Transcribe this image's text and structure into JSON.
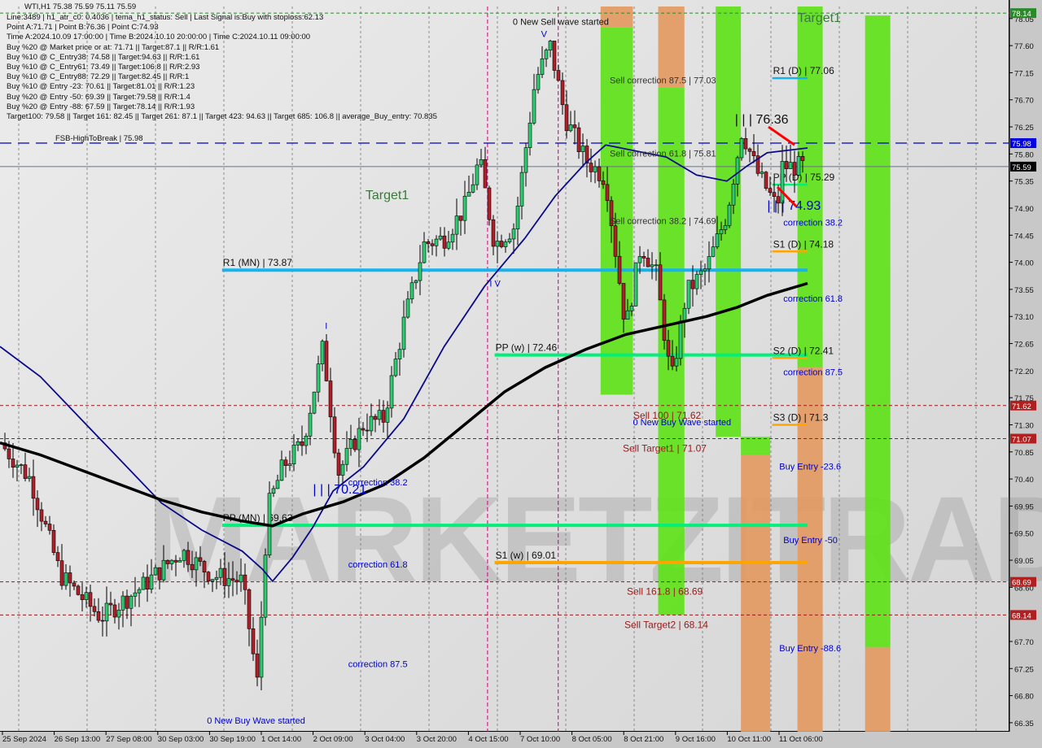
{
  "header": {
    "symbol_line": "WTI,H1  75.38 75.59 75.11 75.59",
    "info_lines": [
      "Line:3489 | h1_atr_c0: 0.4036 | tema_h1_status: Sell | Last Signal is:Buy with stoploss:62.13",
      "Point A:71.71 | Point B:76.36 | Point C:74.93",
      "Time A:2024.10.09 17:00:00 | Time B:2024.10.10 20:00:00 | Time C:2024.10.11 09:00:00",
      "Buy %20 @ Market price or at: 71.71 || Target:87.1 || R/R:1.61",
      "Buy %10 @ C_Entry38: 74.58 || Target:94.63 || R/R:1.61",
      "Buy %10 @ C_Entry61: 73.49 || Target:106.8 || R/R:2.93",
      "Buy %10 @ C_Entry88: 72.29 || Target:82.45 || R/R:1",
      "Buy %10 @ Entry -23: 70.61 || Target:81.01 || R/R:1.23",
      "Buy %20 @ Entry -50: 69.39 || Target:79.58 || R/R:1.4",
      "Buy %20 @ Entry -88: 67.59 || Target:78.14 || R/R:1.93",
      "Target100: 79.58 || Target 161: 82.45 || Target 261: 87.1 || Target 423: 94.63 || Target 685: 106.8 || average_Buy_entry: 70.835"
    ]
  },
  "watermark": "MARKETZITRADE",
  "colors": {
    "bull": "#2ecc71",
    "bear": "#b0202a",
    "ema_blue": "#0a0a8a",
    "ema_black": "#000000",
    "zone_green": "#5fe21a",
    "zone_green_dark": "#46c81e",
    "zone_orange": "#e39a62",
    "pivot_cyan": "#16b4ef",
    "pivot_green": "#00f07a",
    "pivot_orange": "#ffa500",
    "sell_red_line": "#9a1818",
    "current_price_bg": "#000000",
    "fsb_bg": "#0000e0",
    "target_bg": "#2a8a2a",
    "level_bg": "#b02020"
  },
  "chart_data": {
    "type": "candlestick",
    "title": "WTI,H1",
    "ohlc_last": {
      "open": 75.38,
      "high": 75.59,
      "low": 75.11,
      "close": 75.59
    },
    "ylim": [
      66.2,
      78.25
    ],
    "y_ticks": [
      "78.05",
      "77.60",
      "77.15",
      "76.70",
      "76.25",
      "75.80",
      "75.35",
      "74.90",
      "74.45",
      "74.00",
      "73.55",
      "73.10",
      "72.65",
      "72.20",
      "71.75",
      "71.30",
      "70.85",
      "70.40",
      "69.95",
      "69.50",
      "69.05",
      "68.60",
      "67.70",
      "67.25",
      "66.80",
      "66.35"
    ],
    "x_ticks": [
      "25 Sep 2024",
      "26 Sep 13:00",
      "27 Sep 08:00",
      "30 Sep 03:00",
      "30 Sep 19:00",
      "1 Oct 14:00",
      "2 Oct 09:00",
      "3 Oct 04:00",
      "3 Oct 20:00",
      "4 Oct 15:00",
      "7 Oct 10:00",
      "8 Oct 05:00",
      "8 Oct 21:00",
      "9 Oct 16:00",
      "10 Oct 11:00",
      "11 Oct 06:00"
    ],
    "price_tags": [
      {
        "value": "78.14",
        "kind": "target"
      },
      {
        "value": "75.98",
        "kind": "fsb"
      },
      {
        "value": "75.59",
        "kind": "current"
      },
      {
        "value": "71.62",
        "kind": "level"
      },
      {
        "value": "71.07",
        "kind": "level"
      },
      {
        "value": "68.69",
        "kind": "level"
      },
      {
        "value": "68.14",
        "kind": "level"
      }
    ],
    "horizontal_levels": [
      {
        "label": "FSB-HighToBreak | 75.98",
        "price": 75.98,
        "style": "dashed-blue"
      },
      {
        "label": "",
        "price": 75.59,
        "style": "solid-gray"
      },
      {
        "label": "Target1",
        "price": 78.14,
        "style": "dashed-green"
      },
      {
        "label": "Sell 100 | 71.62",
        "price": 71.62,
        "style": "dashed-red"
      },
      {
        "label": "Sell Target1 | 71.07",
        "price": 71.07,
        "style": "dashed-red"
      },
      {
        "label": "Sell 161.8 | 68.69",
        "price": 68.69,
        "style": "dashed-red"
      },
      {
        "label": "Sell Target2 | 68.14",
        "price": 68.14,
        "style": "dashed-red"
      }
    ],
    "pivots": [
      {
        "label": "R1 (MN) | 73.87",
        "price": 73.87,
        "color": "cyan",
        "x0": 0.22,
        "x1": 0.8
      },
      {
        "label": "PP (MN) | 69.63",
        "price": 69.63,
        "color": "green",
        "x0": 0.22,
        "x1": 0.8
      },
      {
        "label": "PP (w) | 72.46",
        "price": 72.46,
        "color": "green",
        "x0": 0.49,
        "x1": 0.8
      },
      {
        "label": "S1 (w) | 69.01",
        "price": 69.01,
        "color": "orange",
        "x0": 0.49,
        "x1": 0.8
      },
      {
        "label": "R1 (D) | 77.06",
        "price": 77.06,
        "color": "cyan",
        "x0": 0.765,
        "x1": 0.8
      },
      {
        "label": "PP (D) | 75.29",
        "price": 75.29,
        "color": "green",
        "x0": 0.765,
        "x1": 0.8
      },
      {
        "label": "S1 (D) | 74.18",
        "price": 74.18,
        "color": "orange",
        "x0": 0.765,
        "x1": 0.8
      },
      {
        "label": "S2 (D) | 72.41",
        "price": 72.41,
        "color": "orange",
        "x0": 0.765,
        "x1": 0.8
      },
      {
        "label": "S3 (D) | 71.3",
        "price": 71.3,
        "color": "orange",
        "x0": 0.765,
        "x1": 0.8
      }
    ],
    "annotations": [
      {
        "text": "0 New Sell wave started",
        "price": 78.0,
        "xf": 0.508,
        "color": "#111"
      },
      {
        "text": "Sell correction 87.5 | 77.03",
        "price": 77.03,
        "xf": 0.604,
        "color": "#333"
      },
      {
        "text": "Sell correction 61.8 | 75.81",
        "price": 75.81,
        "xf": 0.604,
        "color": "#333"
      },
      {
        "text": "Sell correction 38.2 | 74.69",
        "price": 74.69,
        "xf": 0.604,
        "color": "#333"
      },
      {
        "text": "| | | 76.36",
        "price": 76.36,
        "xf": 0.728,
        "color": "#111",
        "big": true
      },
      {
        "text": "| | | 74.93",
        "price": 74.93,
        "xf": 0.76,
        "color": "#0000cc",
        "big": true
      },
      {
        "text": "| | | 70.21",
        "price": 70.21,
        "xf": 0.31,
        "color": "#0000cc",
        "big": true
      },
      {
        "text": "correction 38.2",
        "price": 74.66,
        "xf": 0.776,
        "color": "#0000cc"
      },
      {
        "text": "correction 61.8",
        "price": 73.4,
        "xf": 0.776,
        "color": "#0000cc"
      },
      {
        "text": "correction 87.5",
        "price": 72.18,
        "xf": 0.776,
        "color": "#0000cc"
      },
      {
        "text": "Buy Entry -23.6",
        "price": 70.61,
        "xf": 0.772,
        "color": "#0000cc"
      },
      {
        "text": "Buy Entry -50",
        "price": 69.39,
        "xf": 0.776,
        "color": "#0000cc"
      },
      {
        "text": "Buy Entry -88.6",
        "price": 67.59,
        "xf": 0.772,
        "color": "#0000cc"
      },
      {
        "text": "correction 38.2",
        "price": 70.35,
        "xf": 0.345,
        "color": "#0000cc"
      },
      {
        "text": "correction 61.8",
        "price": 68.98,
        "xf": 0.345,
        "color": "#0000cc"
      },
      {
        "text": "correction 87.5",
        "price": 67.33,
        "xf": 0.345,
        "color": "#0000cc"
      },
      {
        "text": "0 New Buy Wave started",
        "price": 66.39,
        "xf": 0.205,
        "color": "#0000cc"
      },
      {
        "text": "0 New Buy Wave started",
        "price": 71.35,
        "xf": 0.627,
        "color": "#0000cc"
      },
      {
        "text": "Target1",
        "price": 75.1,
        "xf": 0.362,
        "color": "#3a7a3a",
        "big": true
      },
      {
        "text": "Target1",
        "price": 78.05,
        "xf": 0.79,
        "color": "#3a7a3a",
        "big": true
      },
      {
        "text": "I V",
        "price": 73.65,
        "xf": 0.485,
        "color": "#0000cc"
      },
      {
        "text": "I",
        "price": 72.95,
        "xf": 0.322,
        "color": "#0000cc"
      },
      {
        "text": "V",
        "price": 77.8,
        "xf": 0.536,
        "color": "#0000cc"
      }
    ],
    "zones": [
      {
        "x0": 0.595,
        "x1": 0.627,
        "top": 78.25,
        "bottom": 77.9,
        "color": "orange"
      },
      {
        "x0": 0.595,
        "x1": 0.627,
        "top": 77.9,
        "bottom": 71.8,
        "color": "green"
      },
      {
        "x0": 0.652,
        "x1": 0.678,
        "top": 78.25,
        "bottom": 76.9,
        "color": "orange"
      },
      {
        "x0": 0.652,
        "x1": 0.678,
        "top": 76.9,
        "bottom": 68.14,
        "color": "green"
      },
      {
        "x0": 0.709,
        "x1": 0.734,
        "top": 78.25,
        "bottom": 71.1,
        "color": "green"
      },
      {
        "x0": 0.734,
        "x1": 0.763,
        "top": 71.1,
        "bottom": 70.8,
        "color": "green"
      },
      {
        "x0": 0.734,
        "x1": 0.763,
        "top": 70.8,
        "bottom": 66.2,
        "color": "orange"
      },
      {
        "x0": 0.79,
        "x1": 0.815,
        "top": 78.25,
        "bottom": 72.25,
        "color": "green"
      },
      {
        "x0": 0.79,
        "x1": 0.815,
        "top": 72.25,
        "bottom": 66.2,
        "color": "orange"
      },
      {
        "x0": 0.857,
        "x1": 0.882,
        "top": 78.1,
        "bottom": 67.6,
        "color": "green"
      },
      {
        "x0": 0.857,
        "x1": 0.882,
        "top": 67.6,
        "bottom": 66.2,
        "color": "orange"
      }
    ],
    "series": [
      {
        "name": "EMA fast (blue)",
        "color": "#0a0a8a",
        "points": [
          [
            0.0,
            72.6
          ],
          [
            0.04,
            72.1
          ],
          [
            0.08,
            71.4
          ],
          [
            0.12,
            70.7
          ],
          [
            0.16,
            70.0
          ],
          [
            0.2,
            69.55
          ],
          [
            0.24,
            69.2
          ],
          [
            0.26,
            68.9
          ],
          [
            0.27,
            68.7
          ],
          [
            0.29,
            69.1
          ],
          [
            0.31,
            69.6
          ],
          [
            0.33,
            70.2
          ],
          [
            0.36,
            70.6
          ],
          [
            0.4,
            71.4
          ],
          [
            0.44,
            72.6
          ],
          [
            0.48,
            73.6
          ],
          [
            0.52,
            74.4
          ],
          [
            0.55,
            75.1
          ],
          [
            0.58,
            75.65
          ],
          [
            0.6,
            75.95
          ],
          [
            0.63,
            75.85
          ],
          [
            0.66,
            75.75
          ],
          [
            0.69,
            75.45
          ],
          [
            0.72,
            75.35
          ],
          [
            0.74,
            75.6
          ],
          [
            0.76,
            75.82
          ],
          [
            0.8,
            75.9
          ]
        ]
      },
      {
        "name": "EMA slow (black)",
        "color": "#000000",
        "points": [
          [
            0.0,
            71.0
          ],
          [
            0.04,
            70.8
          ],
          [
            0.08,
            70.55
          ],
          [
            0.12,
            70.3
          ],
          [
            0.16,
            70.05
          ],
          [
            0.2,
            69.85
          ],
          [
            0.24,
            69.7
          ],
          [
            0.27,
            69.62
          ],
          [
            0.3,
            69.82
          ],
          [
            0.34,
            70.02
          ],
          [
            0.38,
            70.3
          ],
          [
            0.42,
            70.75
          ],
          [
            0.46,
            71.3
          ],
          [
            0.5,
            71.85
          ],
          [
            0.54,
            72.25
          ],
          [
            0.58,
            72.55
          ],
          [
            0.62,
            72.8
          ],
          [
            0.66,
            72.95
          ],
          [
            0.7,
            73.1
          ],
          [
            0.73,
            73.25
          ],
          [
            0.76,
            73.45
          ],
          [
            0.8,
            73.65
          ]
        ]
      }
    ],
    "vertical_markers": [
      {
        "xf": 0.483,
        "color": "#cc0077"
      },
      {
        "xf": 0.553,
        "color": "#cc0077"
      }
    ]
  }
}
